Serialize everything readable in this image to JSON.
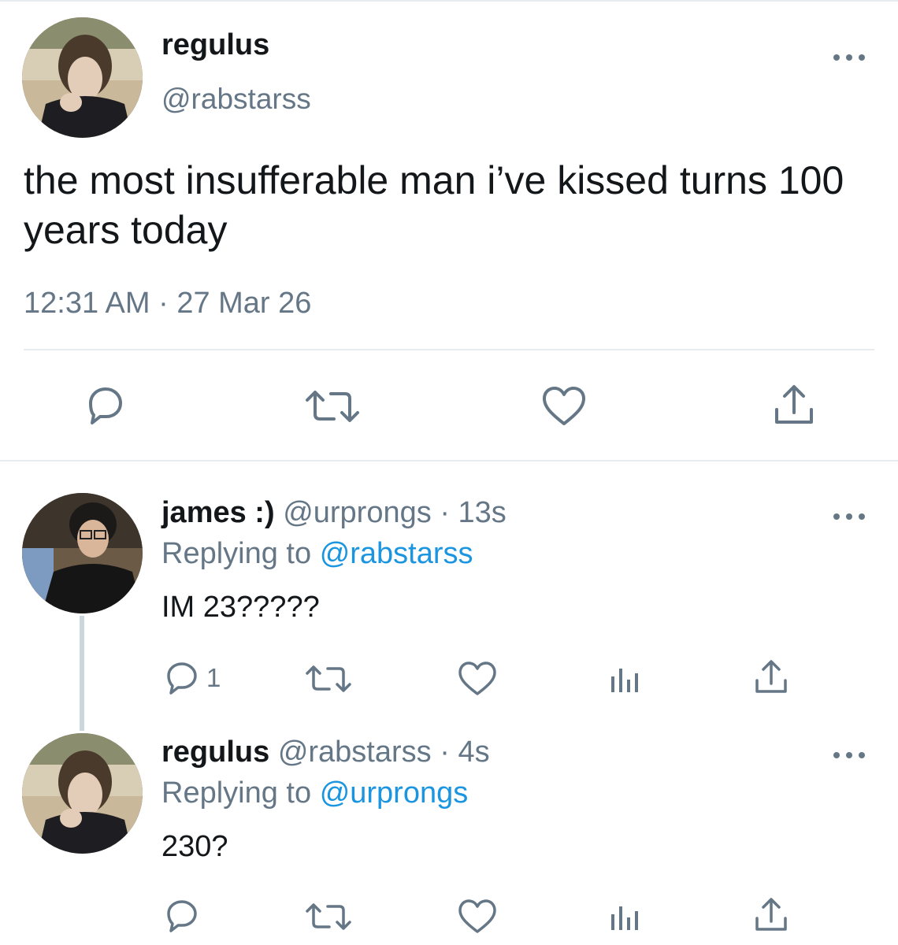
{
  "main_tweet": {
    "display_name": "regulus",
    "handle": "@rabstarss",
    "text": "the most insufferable man i’ve kissed turns 100 years today",
    "timestamp": "12:31 AM · 27 Mar 26",
    "actions": [
      "reply-icon",
      "retweet-icon",
      "like-icon",
      "share-icon"
    ]
  },
  "replies": [
    {
      "display_name": "james :)",
      "handle": "@urprongs",
      "separator": "·",
      "time": "13s",
      "replying_prefix": "Replying to",
      "replying_to": "@rabstarss",
      "text": "IM 23?????",
      "reply_count": "1",
      "actions": [
        "reply-icon",
        "retweet-icon",
        "like-icon",
        "analytics-icon",
        "share-icon"
      ]
    },
    {
      "display_name": "regulus",
      "handle": "@rabstarss",
      "separator": "·",
      "time": "4s",
      "replying_prefix": "Replying to",
      "replying_to": "@urprongs",
      "text": "230?",
      "reply_count": "",
      "actions": [
        "reply-icon",
        "retweet-icon",
        "like-icon",
        "analytics-icon",
        "share-icon"
      ]
    }
  ],
  "colors": {
    "text": "#14171a",
    "secondary": "#657786",
    "link": "#1b95e0",
    "divider": "#e6ecf0"
  }
}
